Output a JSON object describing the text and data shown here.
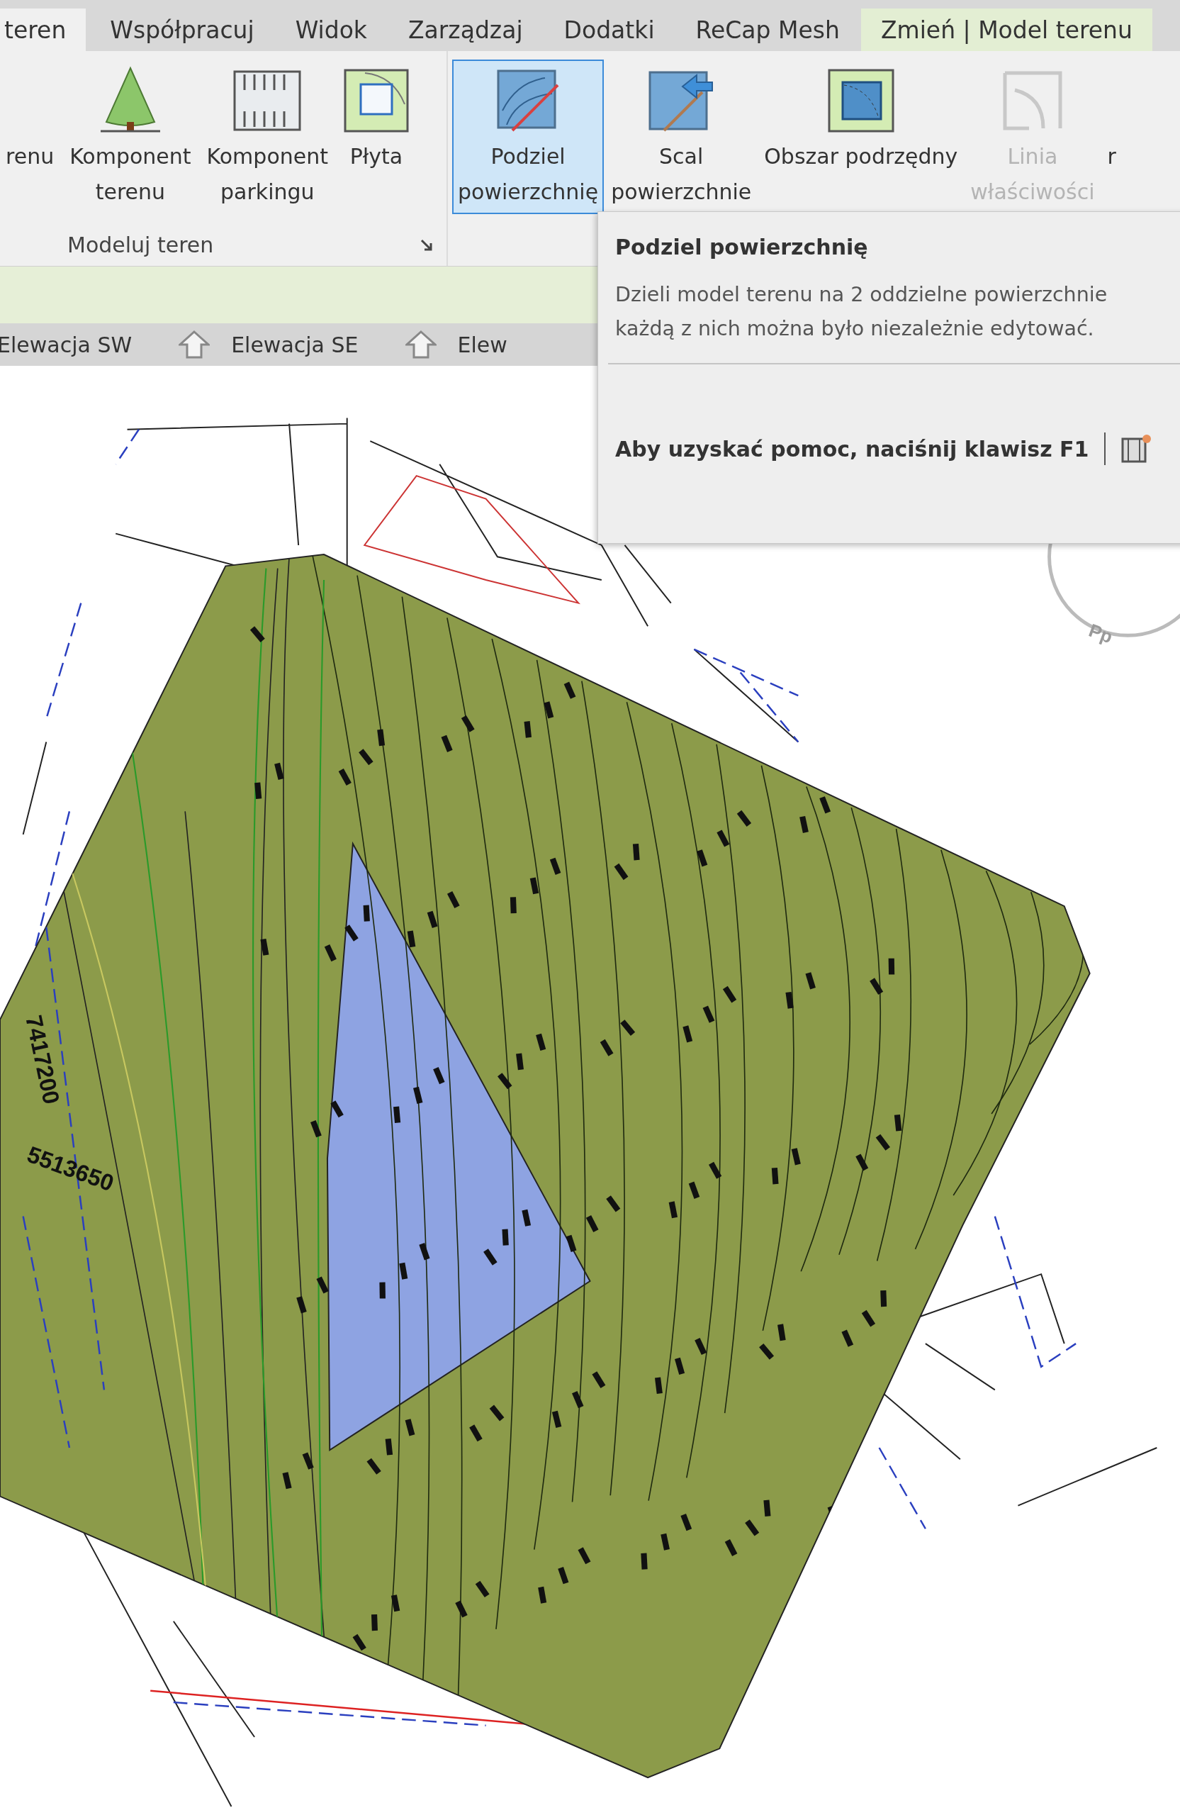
{
  "ribbon_tabs": [
    {
      "label": "teren",
      "selected": true,
      "kind": "normal"
    },
    {
      "label": "Współpracuj",
      "selected": false,
      "kind": "normal"
    },
    {
      "label": "Widok",
      "selected": false,
      "kind": "normal"
    },
    {
      "label": "Zarządzaj",
      "selected": false,
      "kind": "normal"
    },
    {
      "label": "Dodatki",
      "selected": false,
      "kind": "normal"
    },
    {
      "label": "ReCap Mesh",
      "selected": false,
      "kind": "normal"
    },
    {
      "label": "Zmień | Model terenu",
      "selected": false,
      "kind": "contextual"
    }
  ],
  "panels": [
    {
      "title": "Modeluj teren",
      "buttons": [
        {
          "lines": [
            "renu"
          ],
          "selected": false,
          "disabled": false
        },
        {
          "lines": [
            "Komponent",
            "terenu"
          ],
          "selected": false,
          "disabled": false
        },
        {
          "lines": [
            "Komponent",
            "parkingu"
          ],
          "selected": false,
          "disabled": false
        },
        {
          "lines": [
            "Płyta"
          ],
          "selected": false,
          "disabled": false
        }
      ]
    },
    {
      "buttons": [
        {
          "lines": [
            "Podziel",
            "powierzchnię"
          ],
          "selected": true,
          "disabled": false
        },
        {
          "lines": [
            "Scal",
            "powierzchnie"
          ],
          "selected": false,
          "disabled": false
        },
        {
          "lines": [
            "Obszar podrzędny"
          ],
          "selected": false,
          "disabled": false
        },
        {
          "lines": [
            "Linia",
            "właściwości"
          ],
          "selected": false,
          "disabled": true
        },
        {
          "lines": [
            "r"
          ],
          "selected": false,
          "disabled": false
        }
      ]
    }
  ],
  "view_tabs": [
    {
      "label": "Elewacja SW"
    },
    {
      "label": "Elewacja SE"
    },
    {
      "label": "Elew"
    }
  ],
  "tooltip": {
    "title": "Podziel powierzchnię",
    "description": [
      "Dzieli model terenu na 2 oddzielne powierzchnie",
      "każdą z nich można było niezależnie edytować."
    ],
    "help": "Aby uzyskać pomoc, naciśnij klawisz F1"
  },
  "map": {
    "labels": [
      "7417200",
      "5513650",
      "Pp"
    ]
  }
}
